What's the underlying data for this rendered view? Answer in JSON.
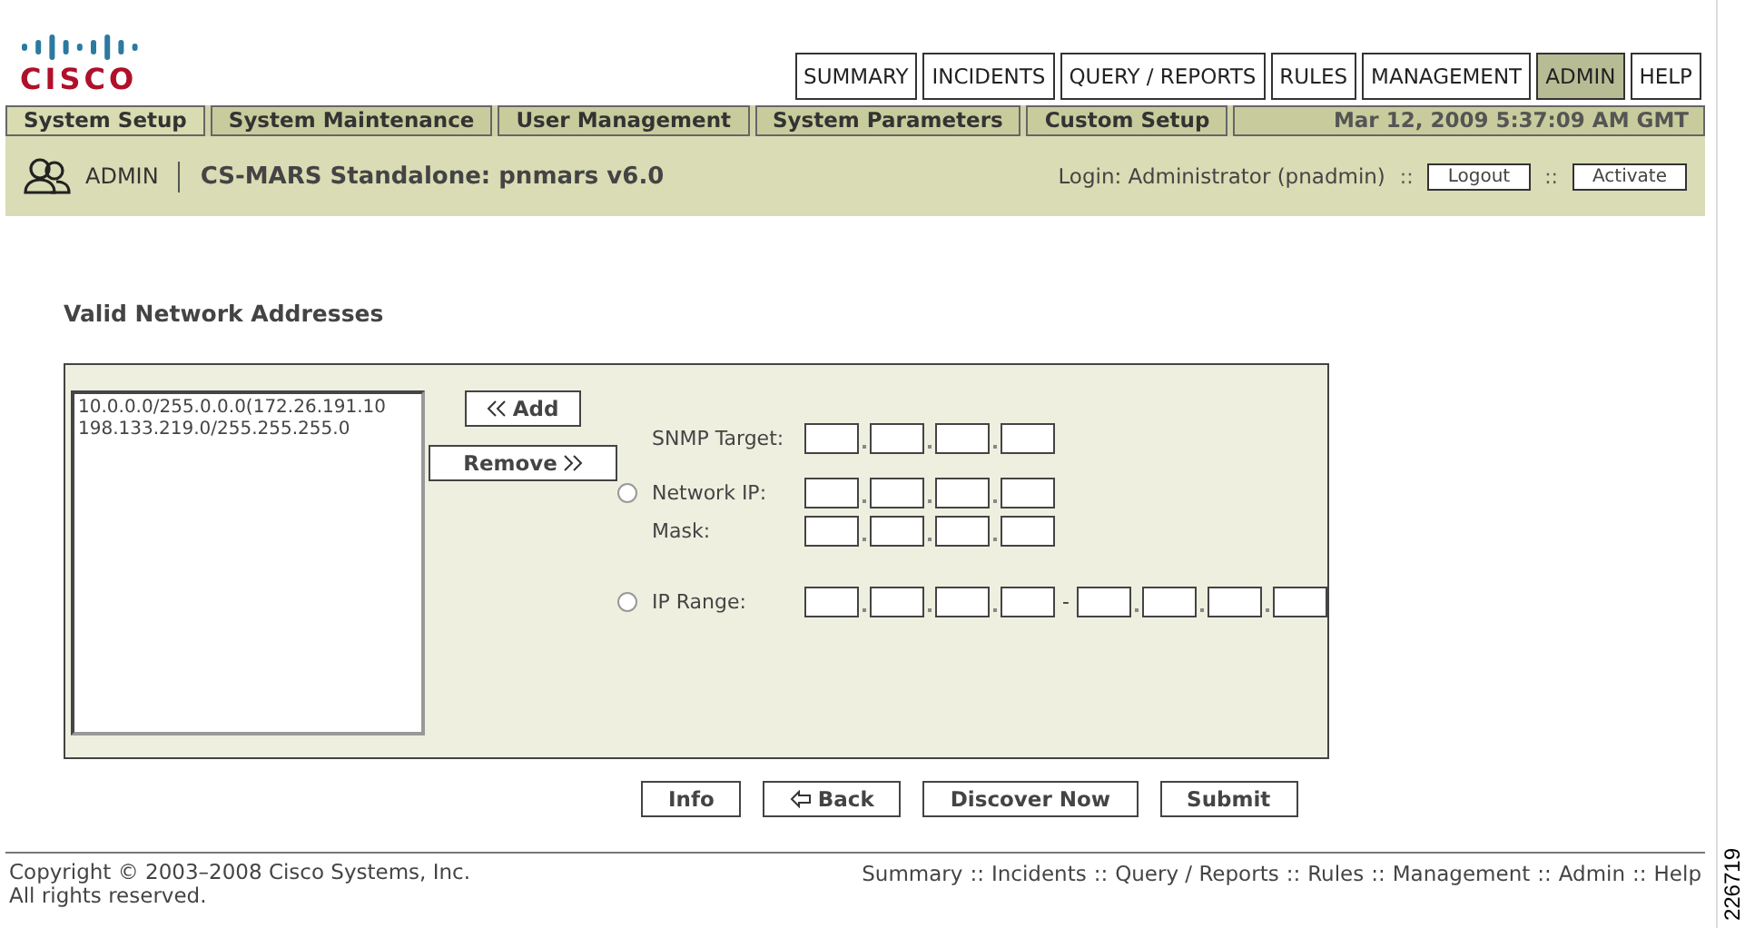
{
  "logo": {
    "text": "CISCO"
  },
  "main_tabs": [
    {
      "label": "SUMMARY",
      "selected": false
    },
    {
      "label": "INCIDENTS",
      "selected": false
    },
    {
      "label": "QUERY / REPORTS",
      "selected": false
    },
    {
      "label": "RULES",
      "selected": false
    },
    {
      "label": "MANAGEMENT",
      "selected": false
    },
    {
      "label": "ADMIN",
      "selected": true
    },
    {
      "label": "HELP",
      "selected": false
    }
  ],
  "sub_tabs": [
    {
      "label": "System Setup",
      "selected": true
    },
    {
      "label": "System Maintenance",
      "selected": false
    },
    {
      "label": "User Management",
      "selected": false
    },
    {
      "label": "System Parameters",
      "selected": false
    },
    {
      "label": "Custom Setup",
      "selected": false
    }
  ],
  "datetime": "Mar 12, 2009 5:37:09 AM GMT",
  "header": {
    "section": "ADMIN",
    "title": "CS-MARS Standalone: pnmars v6.0",
    "login": "Login: Administrator (pnadmin)",
    "sep": "::",
    "logout": "Logout",
    "activate": "Activate"
  },
  "page_title": "Valid Network Addresses",
  "address_list": [
    "10.0.0.0/255.0.0.0(172.26.191.10",
    "198.133.219.0/255.255.255.0"
  ],
  "add_button": "Add",
  "remove_button": "Remove",
  "snmp_target": {
    "label": "SNMP Target:"
  },
  "network_ip": {
    "label": "Network IP:",
    "selected": false
  },
  "mask": {
    "label": "Mask:"
  },
  "ip_range": {
    "label": "IP Range:",
    "selected": false,
    "separator": "-"
  },
  "buttons": [
    {
      "label": "Info",
      "kind": "plain"
    },
    {
      "label": "Back",
      "kind": "back"
    },
    {
      "label": "Discover Now",
      "kind": "plain"
    },
    {
      "label": "Submit",
      "kind": "plain"
    }
  ],
  "footer": {
    "copyright": "Copyright © 2003–2008 Cisco Systems, Inc.",
    "rights": "All rights reserved.",
    "links": [
      "Summary",
      "Incidents",
      "Query / Reports",
      "Rules",
      "Management",
      "Admin",
      "Help"
    ],
    "link_sep": "::"
  },
  "figure_id": "226719"
}
